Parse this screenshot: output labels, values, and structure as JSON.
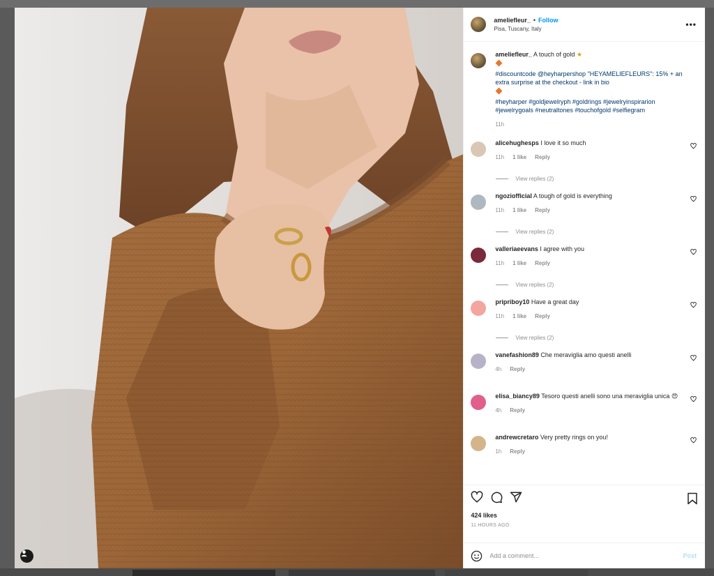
{
  "header": {
    "username": "ameliefleur_",
    "dot": "•",
    "follow_label": "Follow",
    "location": "Pisa, Tuscany, Italy"
  },
  "caption": {
    "username": "ameliefleur_",
    "title": "A touch of gold",
    "line1": "#discountcode @heyharpershop \"HEYAMELIEFLEURS\": 15% + an extra surprise at the checkout - link in bio",
    "hashtags": "#heyharper #goldjewelryph #goldrings #jewelryinspirarion #jewelrygoals #neutraltones #touchofgold #selfiegram",
    "time": "11h"
  },
  "comments": [
    {
      "user": "alicehughesps",
      "text": "I love it so much",
      "time": "11h",
      "likes": "1 like",
      "reply": "Reply",
      "view_replies": "View replies (2)",
      "avatar_color": "#d9c7b6"
    },
    {
      "user": "ngoziofficial",
      "text": "A tough of gold is everything",
      "time": "11h",
      "likes": "1 like",
      "reply": "Reply",
      "view_replies": "View replies (2)",
      "avatar_color": "#aeb8c0"
    },
    {
      "user": "valleriaeevans",
      "text": "I agree with you",
      "time": "11h",
      "likes": "1 like",
      "reply": "Reply",
      "view_replies": "View replies (2)",
      "avatar_color": "#7a2a3a"
    },
    {
      "user": "pripriboy10",
      "text": "Have a great day",
      "time": "11h",
      "likes": "1 like",
      "reply": "Reply",
      "view_replies": "View replies (2)",
      "avatar_color": "#f3a5a0"
    },
    {
      "user": "vanefashion89",
      "text": "Che meraviglia amo questi anelli",
      "time": "4h",
      "reply": "Reply",
      "avatar_color": "#b8b2c8"
    },
    {
      "user": "elisa_biancy89",
      "text": "Tesoro questi anelli sono una meraviglia unica",
      "emoji": "😍",
      "time": "4h",
      "reply": "Reply",
      "avatar_color": "#e0608a"
    },
    {
      "user": "andrewcretaro",
      "text": "Very pretty rings on you!",
      "time": "1h",
      "reply": "Reply",
      "avatar_color": "#d4b48a"
    }
  ],
  "actions": {
    "likes": "424 likes",
    "time_ago": "11 HOURS AGO",
    "comment_placeholder": "Add a comment...",
    "post_label": "Post"
  },
  "colors": {
    "accent": "#0095f6",
    "hashtag": "#00376b",
    "muted": "#8e8e8e",
    "sweater": "#9b6539"
  },
  "icons": [
    "heart-icon",
    "comment-icon",
    "share-icon",
    "bookmark-icon",
    "more-options-icon",
    "emoji-icon",
    "user-tag-icon",
    "caption-emoji-icon"
  ]
}
